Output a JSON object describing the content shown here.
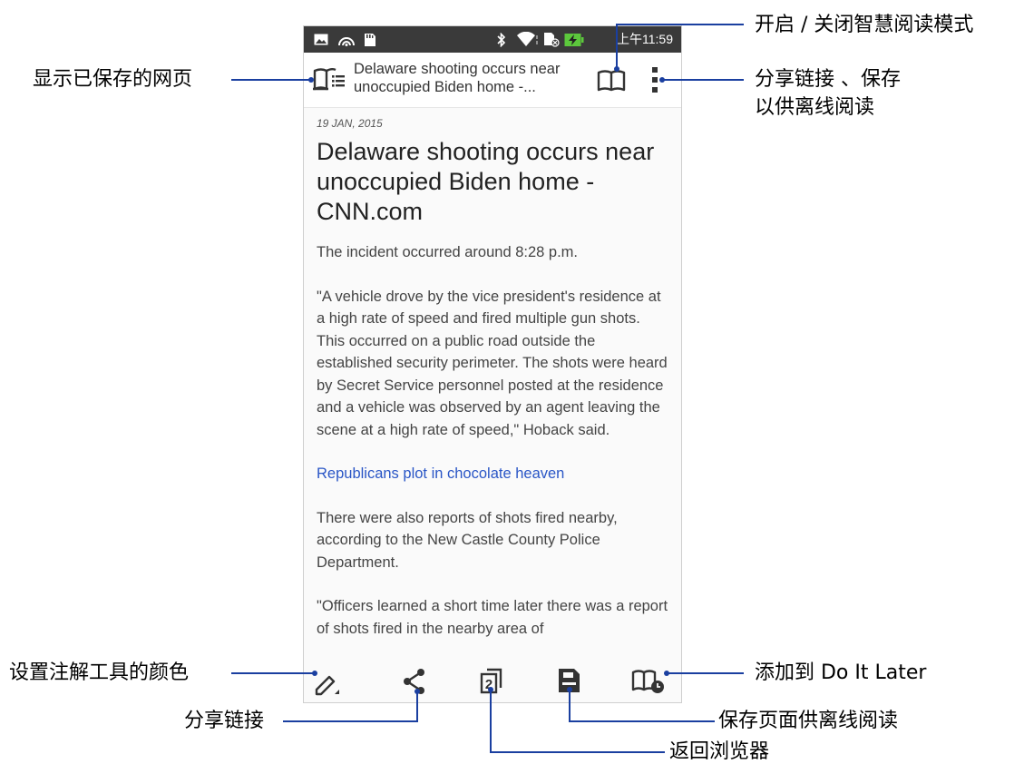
{
  "status_bar": {
    "time": "上午11:59",
    "left_icons": [
      "image-icon",
      "hotspot-icon",
      "sd-card-icon"
    ],
    "right_icons": [
      "bluetooth-icon",
      "wifi-icon",
      "sim-icon",
      "battery-charging-icon"
    ]
  },
  "app_bar": {
    "title_line1": "Delaware shooting occurs near",
    "title_line2": "unoccupied Biden home -...",
    "icons": [
      "saved-pages-icon",
      "reading-mode-icon",
      "more-options-icon"
    ]
  },
  "article": {
    "date": "19 JAN, 2015",
    "headline": "Delaware shooting occurs near unoccupied Biden home - CNN.com",
    "paragraphs": [
      "The incident occurred around 8:28 p.m.",
      "\"A vehicle drove by the vice president's residence at a high rate of speed and fired multiple gun shots. This occurred on a public road outside the established security perimeter. The shots were heard by Secret Service personnel posted at the residence and a vehicle was observed by an agent leaving the scene at a high rate of speed,\" Hoback said.",
      "Republicans plot in chocolate heaven",
      "There were also reports of shots fired nearby, according to the New Castle County Police Department.",
      "\"Officers learned a short time later there was a report of shots fired in the nearby area of"
    ],
    "link_color": "#2a56c6"
  },
  "bottom_bar": {
    "icons": [
      "annotate-pen-icon",
      "share-icon",
      "tabs-icon",
      "save-page-icon",
      "do-it-later-icon"
    ]
  },
  "callouts": {
    "saved_pages": "显示已保存的网页",
    "reading_mode": "开启 / 关闭智慧阅读模式",
    "share_save_line1": "分享链接 、保存",
    "share_save_line2": "以供离线阅读",
    "annotate_color": "设置注解工具的颜色",
    "share_link": "分享链接",
    "back_browser": "返回浏览器",
    "save_offline": "保存页面供离线阅读",
    "do_it_later": "添加到 Do It Later"
  },
  "colors": {
    "status_bar": "#3a3a3a",
    "callout_line": "#1a3fa0",
    "battery": "#5cc83c"
  }
}
